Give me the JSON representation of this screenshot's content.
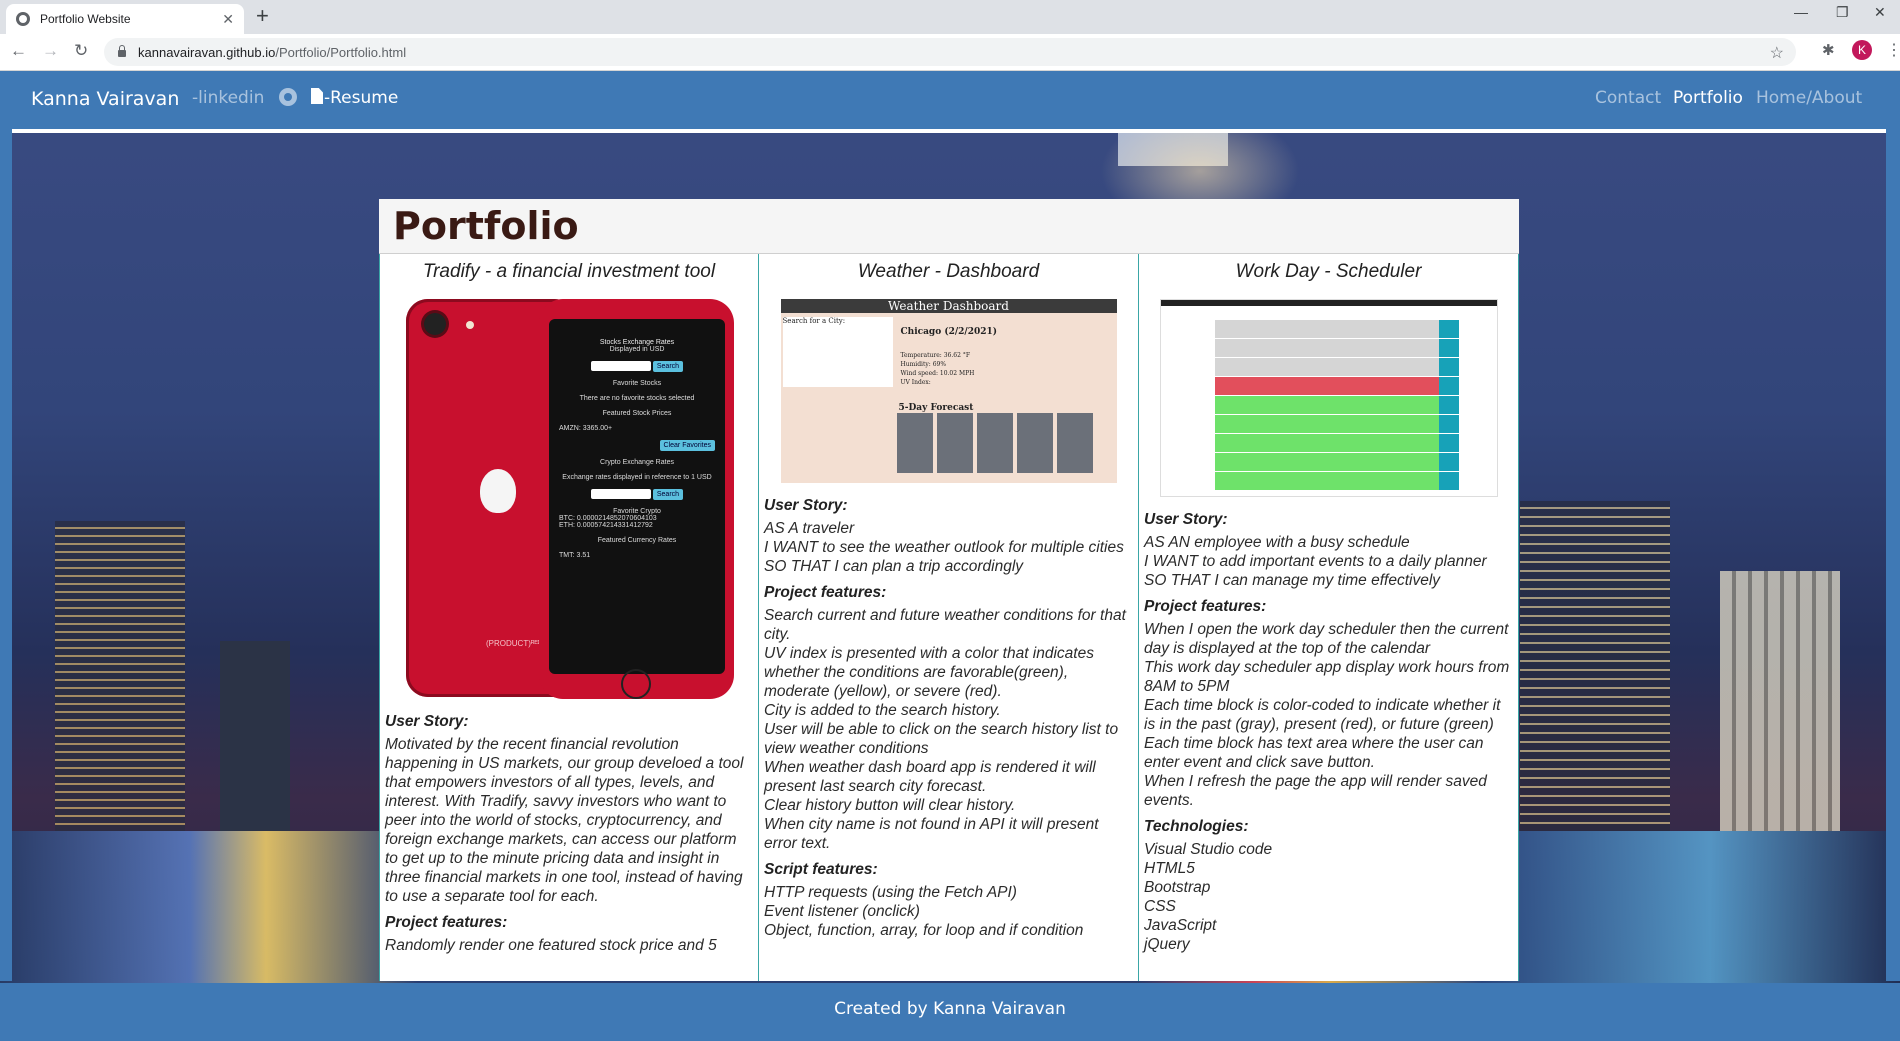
{
  "browser": {
    "tab_title": "Portfolio Website",
    "url_host": "kannavairavan.github.io",
    "url_path": "/Portfolio/Portfolio.html",
    "avatar_letter": "K"
  },
  "nav": {
    "brand": "Kanna Vairavan",
    "linkedin": "-linkedin",
    "resume": "-Resume",
    "contact": "Contact",
    "portfolio": "Portfolio",
    "home": "Home/About"
  },
  "page_title": "Portfolio",
  "projects": [
    {
      "title": "Tradify - a financial investment tool",
      "user_story_h": "User Story:",
      "user_story": "Motivated by the recent financial revolution happening in US markets, our group develoed a tool that empowers investors of all types, levels, and interest. With Tradify, savvy investors who want to peer into the world of stocks, cryptocurrency, and foreign exchange markets, can access our platform to get up to the minute pricing data and insight in three financial markets in one tool, instead of having to use a separate tool for each.",
      "features_h": "Project features:",
      "features": "Randomly render one featured stock price and 5",
      "screen": {
        "stocks_title": "Stocks Exchange Rates",
        "stocks_sub": "Displayed in USD",
        "search": "Search",
        "fav_stocks": "Favorite Stocks",
        "no_fav": "There are no favorite stocks selected",
        "featured": "Featured Stock Prices",
        "amzn": "AMZN: 3365.00+",
        "clear": "Clear Favorites",
        "crypto_title": "Crypto Exchange Rates",
        "crypto_sub": "Exchange rates displayed in reference to 1 USD",
        "fav_crypto": "Favorite Crypto",
        "btc": "BTC: 0.0000214852070604103",
        "eth": "ETH: 0.000574214331412792",
        "currency": "Featured Currency Rates",
        "tmt": "TMT: 3.51"
      }
    },
    {
      "title": "Weather - Dashboard",
      "user_story_h": "User Story:",
      "user_story": "AS A traveler\nI WANT to see the weather outlook for multiple cities\nSO THAT I can plan a trip accordingly",
      "features_h": "Project features:",
      "features": "Search current and future weather conditions for that city.\nUV index is presented with a color that indicates whether the conditions are favorable(green), moderate (yellow), or severe (red).\nCity is added to the search history.\nUser will be able to click on the search history list to view weather conditions\nWhen weather dash board app is rendered it will present last search city forecast.\nClear history button will clear history.\nWhen city name is not found in API it will present error text.",
      "script_h": "Script features:",
      "script": "HTTP requests (using the Fetch API)\nEvent listener (onclick)\nObject, function, array, for loop and if condition",
      "screen": {
        "header": "Weather Dashboard",
        "search_label": "Search for a City:",
        "city": "Chicago (2/2/2021)",
        "stats": "Temperature: 36.62 °F\nHumidity: 69%\nWind speed: 10.02 MPH\nUV Index:",
        "forecast": "5-Day Forecast"
      }
    },
    {
      "title": "Work Day - Scheduler",
      "user_story_h": "User Story:",
      "user_story": "AS AN employee with a busy schedule\nI WANT to add important events to a daily planner\nSO THAT I can manage my time effectively",
      "features_h": "Project features:",
      "features": "When I open the work day scheduler then the current day is displayed at the top of the calendar\nThis work day scheduler app display work hours from 8AM to 5PM\nEach time block is color-coded to indicate whether it is in the past (gray), present (red), or future (green)\nEach time block has text area where the user can enter event and click save button.\nWhen I refresh the page the app will render saved events.",
      "tech_h": "Technologies:",
      "tech": [
        "Visual Studio code",
        "HTML5",
        "Bootstrap",
        "CSS",
        "JavaScript",
        "jQuery"
      ]
    }
  ],
  "footer": "Created by Kanna Vairavan",
  "colors": {
    "nav": "#3f79b5",
    "accent_border": "#3aa6a6"
  }
}
